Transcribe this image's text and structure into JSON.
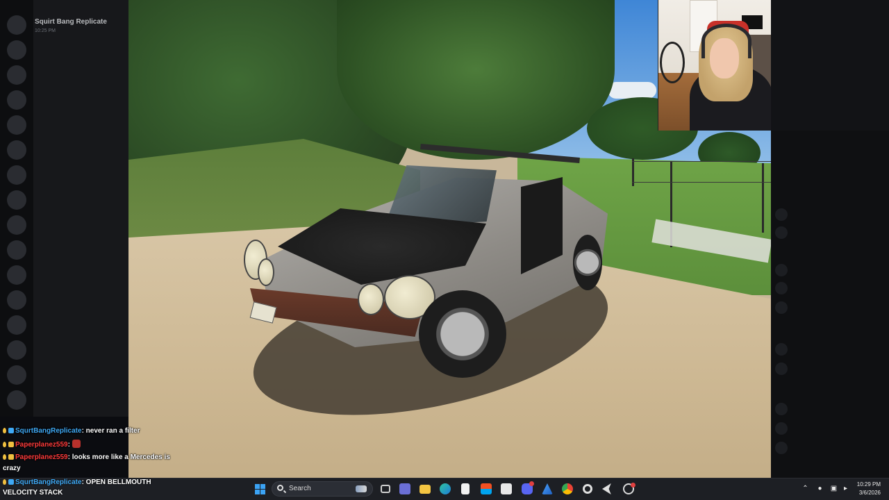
{
  "discord": {
    "server_title": "Squirt Bang Replicate",
    "time": "10:25 PM"
  },
  "chat": {
    "messages": [
      {
        "user": "SqurtBangReplicate",
        "text": ": never ran a filter",
        "user_color": "#3fa9f5"
      },
      {
        "user": "Paperplanez559",
        "text": ": ",
        "user_color": "#ff3b3b",
        "emote": "red-face-emote"
      },
      {
        "user": "Paperplanez559",
        "text": ": looks more like a Mercedes is",
        "user_color": "#ff3b3b",
        "continuation": "crazy"
      },
      {
        "user": "SqurtBangReplicate",
        "text": ": OPEN BELLMOUTH",
        "user_color": "#3fa9f5"
      }
    ],
    "overlay_label": "VELOCITY STACK"
  },
  "taskbar": {
    "search_label": "Search",
    "clock_time": "10:29 PM",
    "clock_date": "3/6/2026",
    "apps": [
      "windows-start",
      "search",
      "file-explorer",
      "teams",
      "folder",
      "edge",
      "notepad",
      "store",
      "chrome-like",
      "discord",
      "azure",
      "chrome",
      "settings",
      "cursor",
      "game-app"
    ],
    "tray": [
      "chevron-up",
      "microphone",
      "display",
      "volume"
    ]
  },
  "colors": {
    "taskbar_bg": "#1d1f24",
    "accent_blue": "#3ba3f5",
    "chat_blue": "#3fa9f5",
    "chat_red": "#ff3b3b"
  }
}
